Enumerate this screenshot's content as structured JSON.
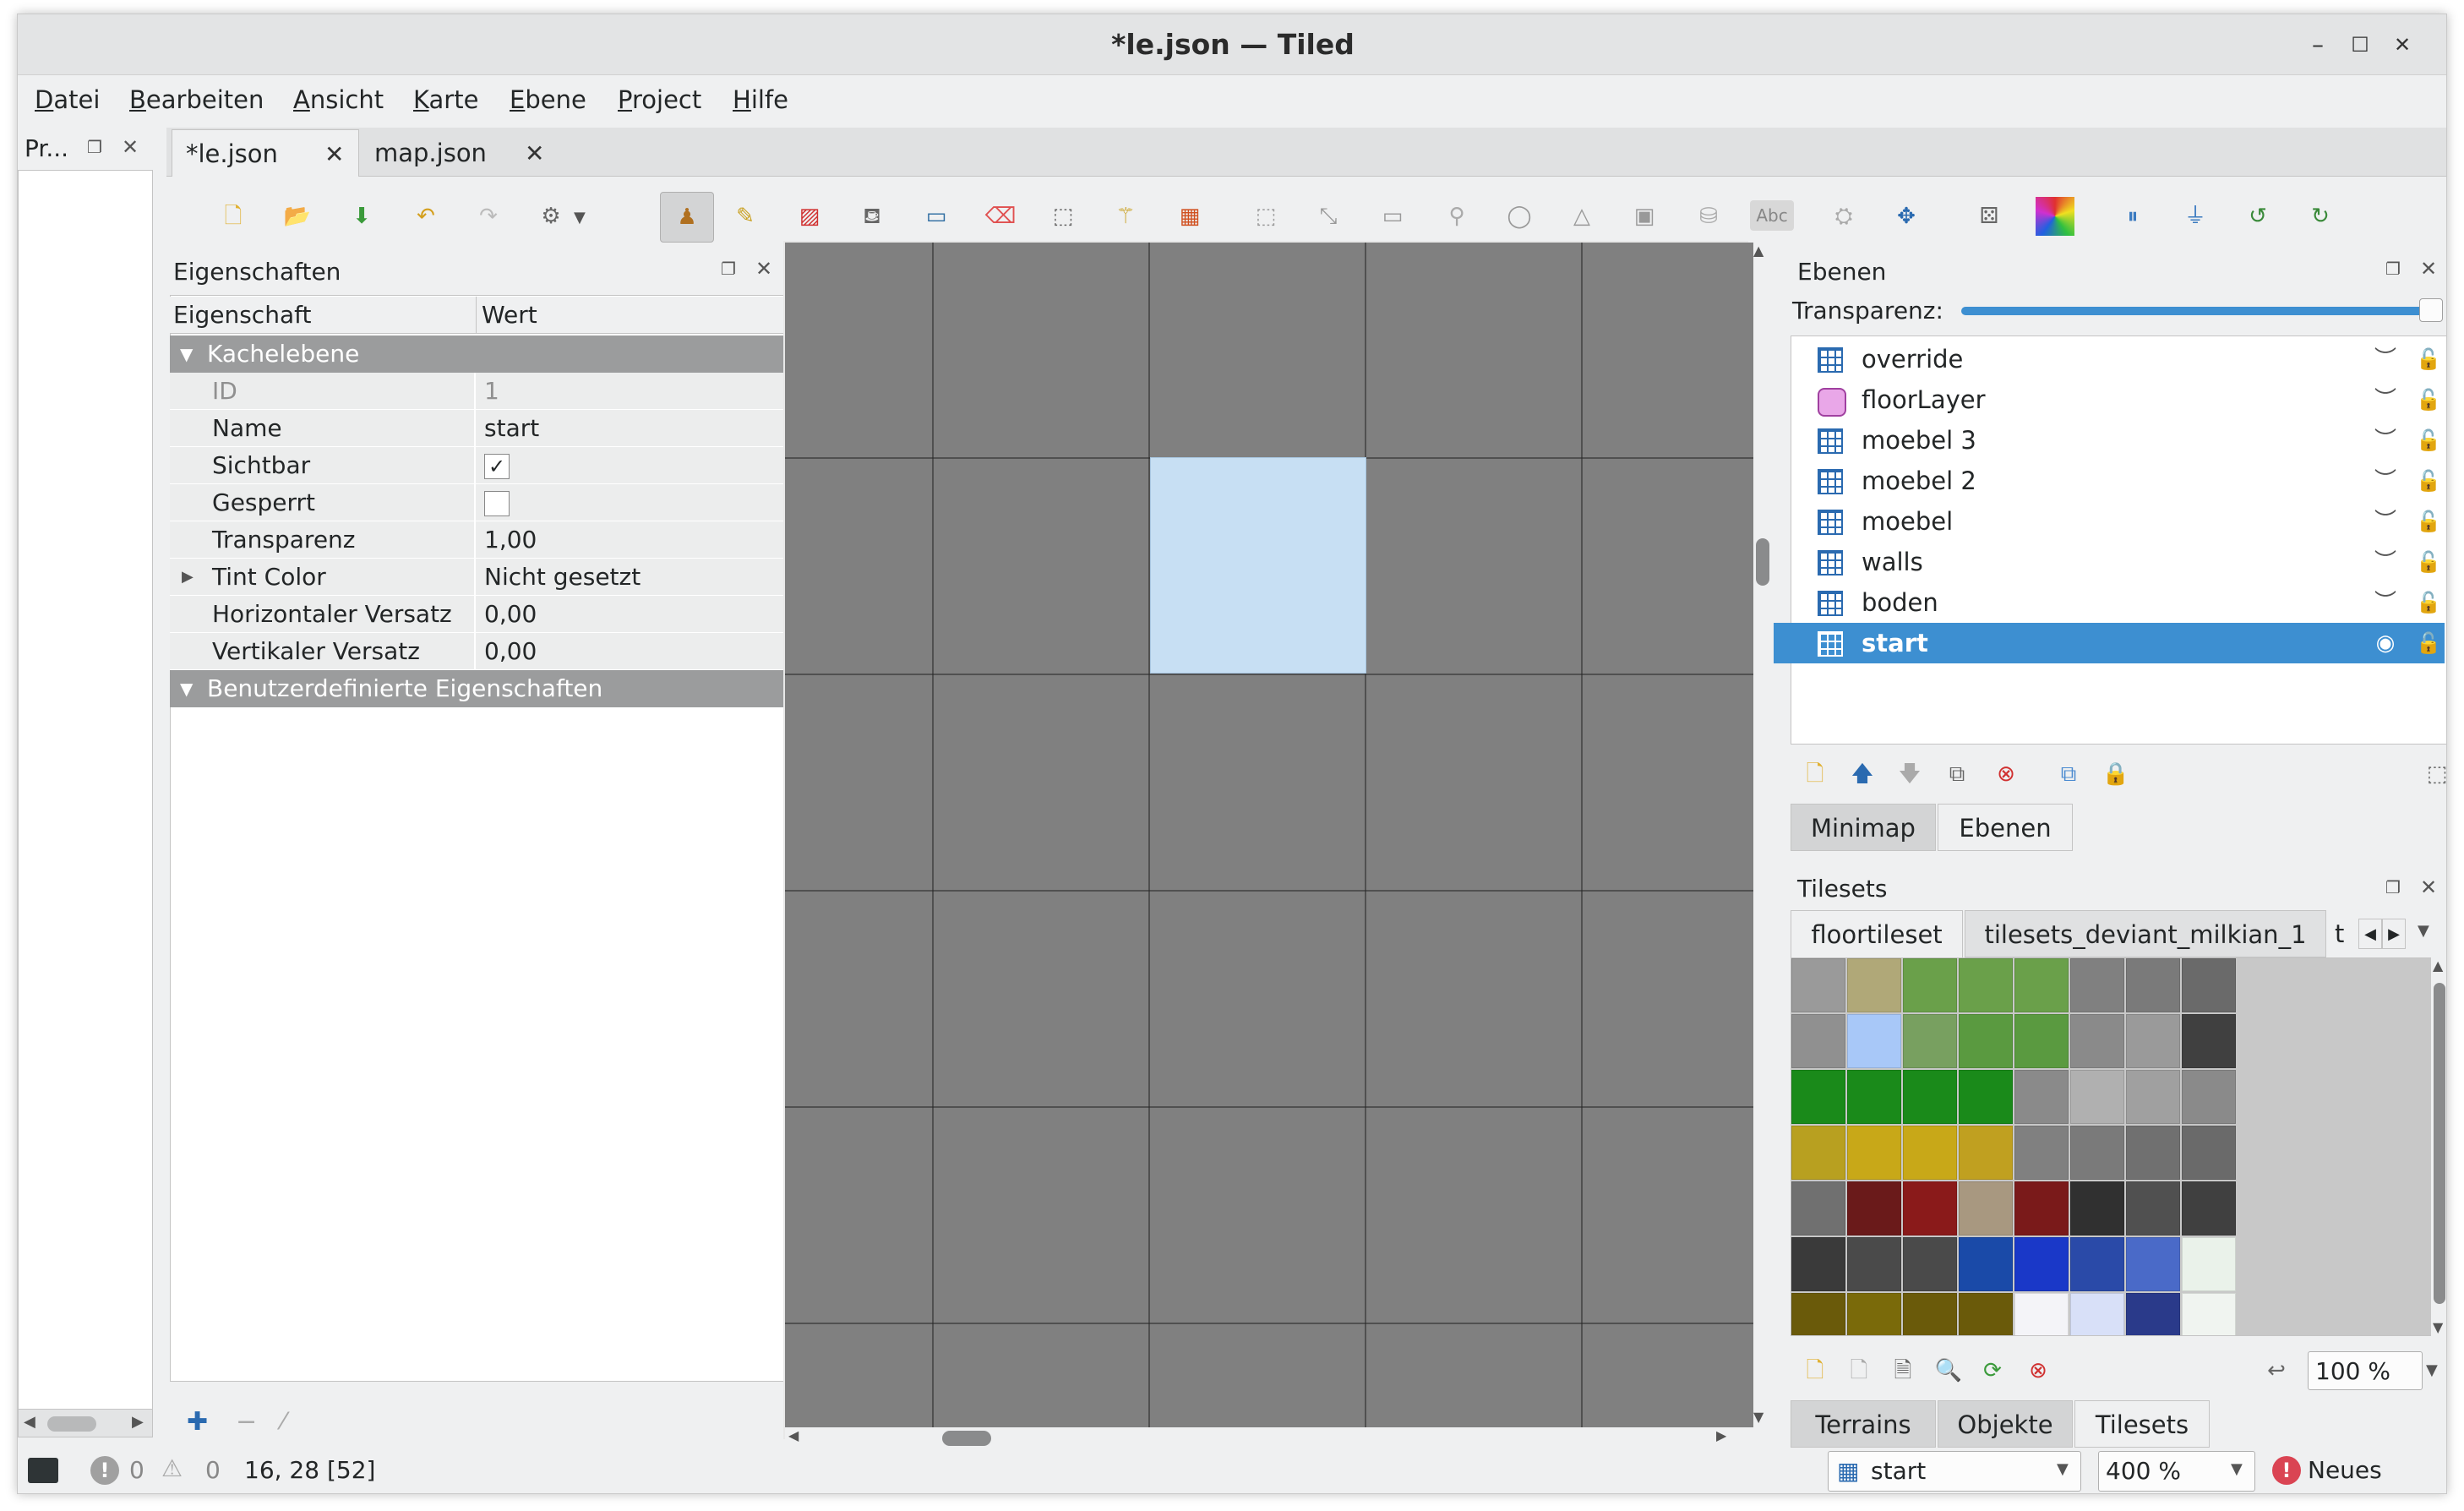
{
  "window": {
    "title": "*le.json — Tiled",
    "minimize": "–",
    "maximize": "☐",
    "close": "✕"
  },
  "menu": [
    "Datei",
    "Bearbeiten",
    "Ansicht",
    "Karte",
    "Ebene",
    "Project",
    "Hilfe"
  ],
  "project_panel": {
    "title": "Pr..."
  },
  "tabs": [
    {
      "label": "*le.json",
      "active": true
    },
    {
      "label": "map.json",
      "active": false
    }
  ],
  "properties": {
    "title": "Eigenschaften",
    "header_property": "Eigenschaft",
    "header_value": "Wert",
    "group_tile_layer": "Kachelebene",
    "rows": [
      {
        "name": "ID",
        "value": "1"
      },
      {
        "name": "Name",
        "value": "start"
      },
      {
        "name": "Sichtbar",
        "value": "✓"
      },
      {
        "name": "Gesperrt",
        "value": ""
      },
      {
        "name": "Transparenz",
        "value": "1,00"
      },
      {
        "name": "Tint Color",
        "value": "Nicht gesetzt"
      },
      {
        "name": "Horizontaler Versatz",
        "value": "0,00"
      },
      {
        "name": "Vertikaler Versatz",
        "value": "0,00"
      }
    ],
    "group_custom": "Benutzerdefinierte Eigenschaften"
  },
  "layers": {
    "title": "Ebenen",
    "opacity_label": "Transparenz:",
    "opacity": 1.0,
    "items": [
      {
        "name": "override",
        "type": "tile"
      },
      {
        "name": "floorLayer",
        "type": "object"
      },
      {
        "name": "moebel 3",
        "type": "tile"
      },
      {
        "name": "moebel 2",
        "type": "tile"
      },
      {
        "name": "moebel",
        "type": "tile"
      },
      {
        "name": "walls",
        "type": "tile"
      },
      {
        "name": "boden",
        "type": "tile"
      },
      {
        "name": "start",
        "type": "tile",
        "selected": true
      }
    ],
    "bottom_tabs": [
      "Minimap",
      "Ebenen"
    ]
  },
  "tilesets": {
    "title": "Tilesets",
    "tabs": [
      "floortileset",
      "tilesets_deviant_milkian_1",
      "t"
    ],
    "zoom": "100 %",
    "bottom_tabs": [
      "Terrains",
      "Objekte",
      "Tilesets"
    ]
  },
  "status": {
    "errors": "0",
    "warnings": "0",
    "position": "16, 28 [52]",
    "layer": "start",
    "zoom": "400 %",
    "news": "Neues"
  },
  "colors": {
    "selection": "#3d8fd1",
    "map_bg": "#808080",
    "tile_blue": "#c7dff3",
    "group_header": "#9b9c9d"
  }
}
